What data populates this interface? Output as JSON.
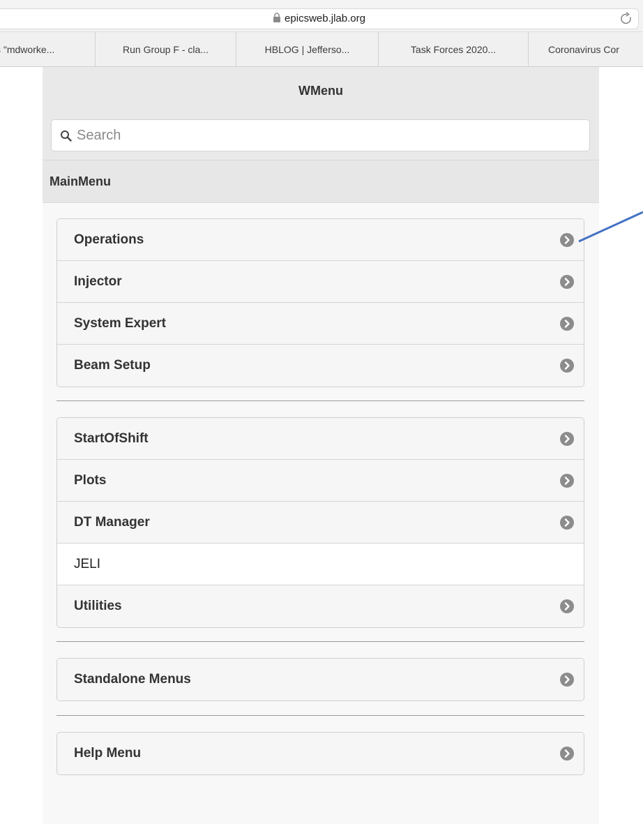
{
  "browser": {
    "url": "epicsweb.jlab.org",
    "tabs": [
      "s \"mdworke...",
      "Run Group F - cla...",
      "HBLOG | Jefferso...",
      "Task Forces 2020...",
      "Coronavirus Cor"
    ]
  },
  "app": {
    "title": "WMenu",
    "search": {
      "placeholder": "Search",
      "value": ""
    },
    "section": "MainMenu",
    "groups": [
      {
        "items": [
          {
            "label": "Operations",
            "icon": "chevron-right-icon"
          },
          {
            "label": "Injector",
            "icon": "chevron-right-icon"
          },
          {
            "label": "System Expert",
            "icon": "chevron-right-icon"
          },
          {
            "label": "Beam Setup",
            "icon": "chevron-right-icon"
          }
        ]
      },
      {
        "items": [
          {
            "label": "StartOfShift",
            "icon": "chevron-right-icon"
          },
          {
            "label": "Plots",
            "icon": "chevron-right-icon"
          },
          {
            "label": "DT Manager",
            "icon": "chevron-right-icon"
          },
          {
            "label": "JELI",
            "icon": null
          },
          {
            "label": "Utilities",
            "icon": "chevron-right-icon"
          }
        ]
      },
      {
        "items": [
          {
            "label": "Standalone Menus",
            "icon": "chevron-right-icon"
          }
        ]
      },
      {
        "items": [
          {
            "label": "Help Menu",
            "icon": "chevron-right-icon"
          }
        ]
      }
    ]
  },
  "colors": {
    "chevron_bg": "#8c8c8c",
    "annotation_arrow": "#4472c4"
  }
}
